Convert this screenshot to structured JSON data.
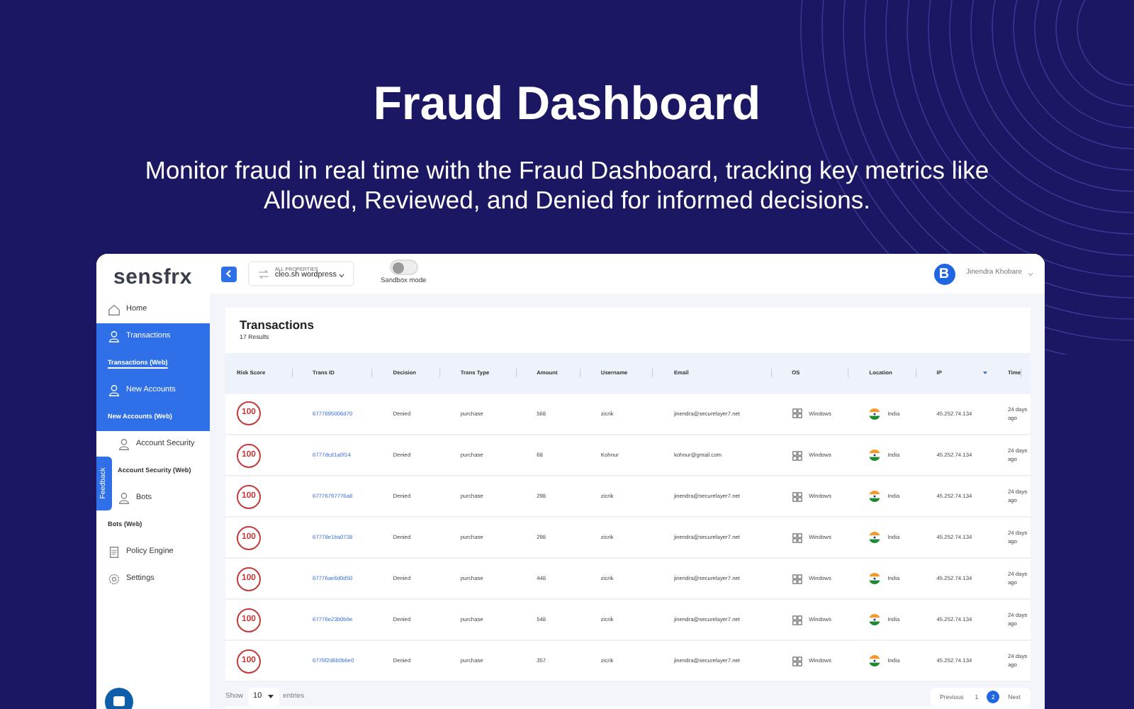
{
  "hero": {
    "title": "Fraud Dashboard",
    "subtitle": "Monitor fraud in real time with the Fraud Dashboard, tracking key metrics like Allowed, Reviewed, and Denied for informed decisions."
  },
  "app": {
    "logo": "sensfrx",
    "sidebar": {
      "items": [
        {
          "label": "Home",
          "kind": "main",
          "active": false,
          "selected": false
        },
        {
          "label": "Transactions",
          "kind": "main",
          "active": true,
          "selected": false
        },
        {
          "label": "Transactions (Web)",
          "kind": "sub",
          "active": true,
          "selected": true
        },
        {
          "label": "New Accounts",
          "kind": "main",
          "active": true,
          "selected": false
        },
        {
          "label": "New Accounts (Web)",
          "kind": "sub",
          "active": true,
          "selected": false
        },
        {
          "label": "Account Security",
          "kind": "main",
          "active": false,
          "selected": false
        },
        {
          "label": "Account Security (Web)",
          "kind": "sub",
          "active": false,
          "selected": false
        },
        {
          "label": "Bots",
          "kind": "main",
          "active": false,
          "selected": false
        },
        {
          "label": "Bots (Web)",
          "kind": "sub",
          "active": false,
          "selected": false
        },
        {
          "label": "Policy Engine",
          "kind": "main",
          "active": false,
          "selected": false
        },
        {
          "label": "Settings",
          "kind": "main",
          "active": false,
          "selected": false
        }
      ]
    },
    "feedback_tab": "Feedback",
    "topbar": {
      "property_label": "ALL PROPERTIES",
      "property": "cleo.sh wordpress",
      "sandbox": {
        "label": "Sandbox mode",
        "on": false
      },
      "avatar": "B",
      "user": "Jinendra Khobare"
    },
    "card": {
      "title": "Transactions",
      "count": "17 Results",
      "table": {
        "columns": [
          {
            "label": "Risk Score",
            "sorted": false
          },
          {
            "label": "Trans ID",
            "sorted": false
          },
          {
            "label": "Decision",
            "sorted": false
          },
          {
            "label": "Trans Type",
            "sorted": false
          },
          {
            "label": "Amount",
            "sorted": false
          },
          {
            "label": "Username",
            "sorted": false
          },
          {
            "label": "Email",
            "sorted": false
          },
          {
            "label": "OS",
            "sorted": false
          },
          {
            "label": "Location",
            "sorted": false
          },
          {
            "label": "IP",
            "sorted": true
          },
          {
            "label": "Time",
            "sorted": false
          }
        ],
        "rows": [
          [
            "100",
            "6777695006d70",
            "Denied",
            "purchase",
            "568",
            "zicrik",
            "jinendra@securelayer7.net",
            "Windows",
            "India",
            "45.252.74.134",
            "24 days ago"
          ],
          [
            "100",
            "6777dcd1a0f14",
            "Denied",
            "purchase",
            "68",
            "Kohnur",
            "kohnur@gmail.com",
            "Windows",
            "India",
            "45.252.74.134",
            "24 days ago"
          ],
          [
            "100",
            "67776797776a8",
            "Denied",
            "purchase",
            "298",
            "zicrik",
            "jinendra@securelayer7.net",
            "Windows",
            "India",
            "45.252.74.134",
            "24 days ago"
          ],
          [
            "100",
            "67778e1ba0738",
            "Denied",
            "purchase",
            "298",
            "zicrik",
            "jinendra@securelayer7.net",
            "Windows",
            "India",
            "45.252.74.134",
            "24 days ago"
          ],
          [
            "100",
            "67776ae6d0d50",
            "Denied",
            "purchase",
            "448",
            "zicrik",
            "jinendra@securelayer7.net",
            "Windows",
            "India",
            "45.252.74.134",
            "24 days ago"
          ],
          [
            "100",
            "67776e23b0b6e",
            "Denied",
            "purchase",
            "548",
            "zicrik",
            "jinendra@securelayer7.net",
            "Windows",
            "India",
            "45.252.74.134",
            "24 days ago"
          ],
          [
            "100",
            "6776f2d6b0b6e0",
            "Denied",
            "purchase",
            "357",
            "zicrik",
            "jinendra@securelayer7.net",
            "Windows",
            "India",
            "45.252.74.134",
            "24 days ago"
          ]
        ]
      },
      "footer": {
        "show": "Show",
        "page_size": "10",
        "entries": "entries",
        "pages": [
          {
            "label": "Previous",
            "selected": false
          },
          {
            "label": "1",
            "selected": false
          },
          {
            "label": "2",
            "selected": true
          },
          {
            "label": "Next",
            "selected": false
          }
        ]
      }
    }
  }
}
